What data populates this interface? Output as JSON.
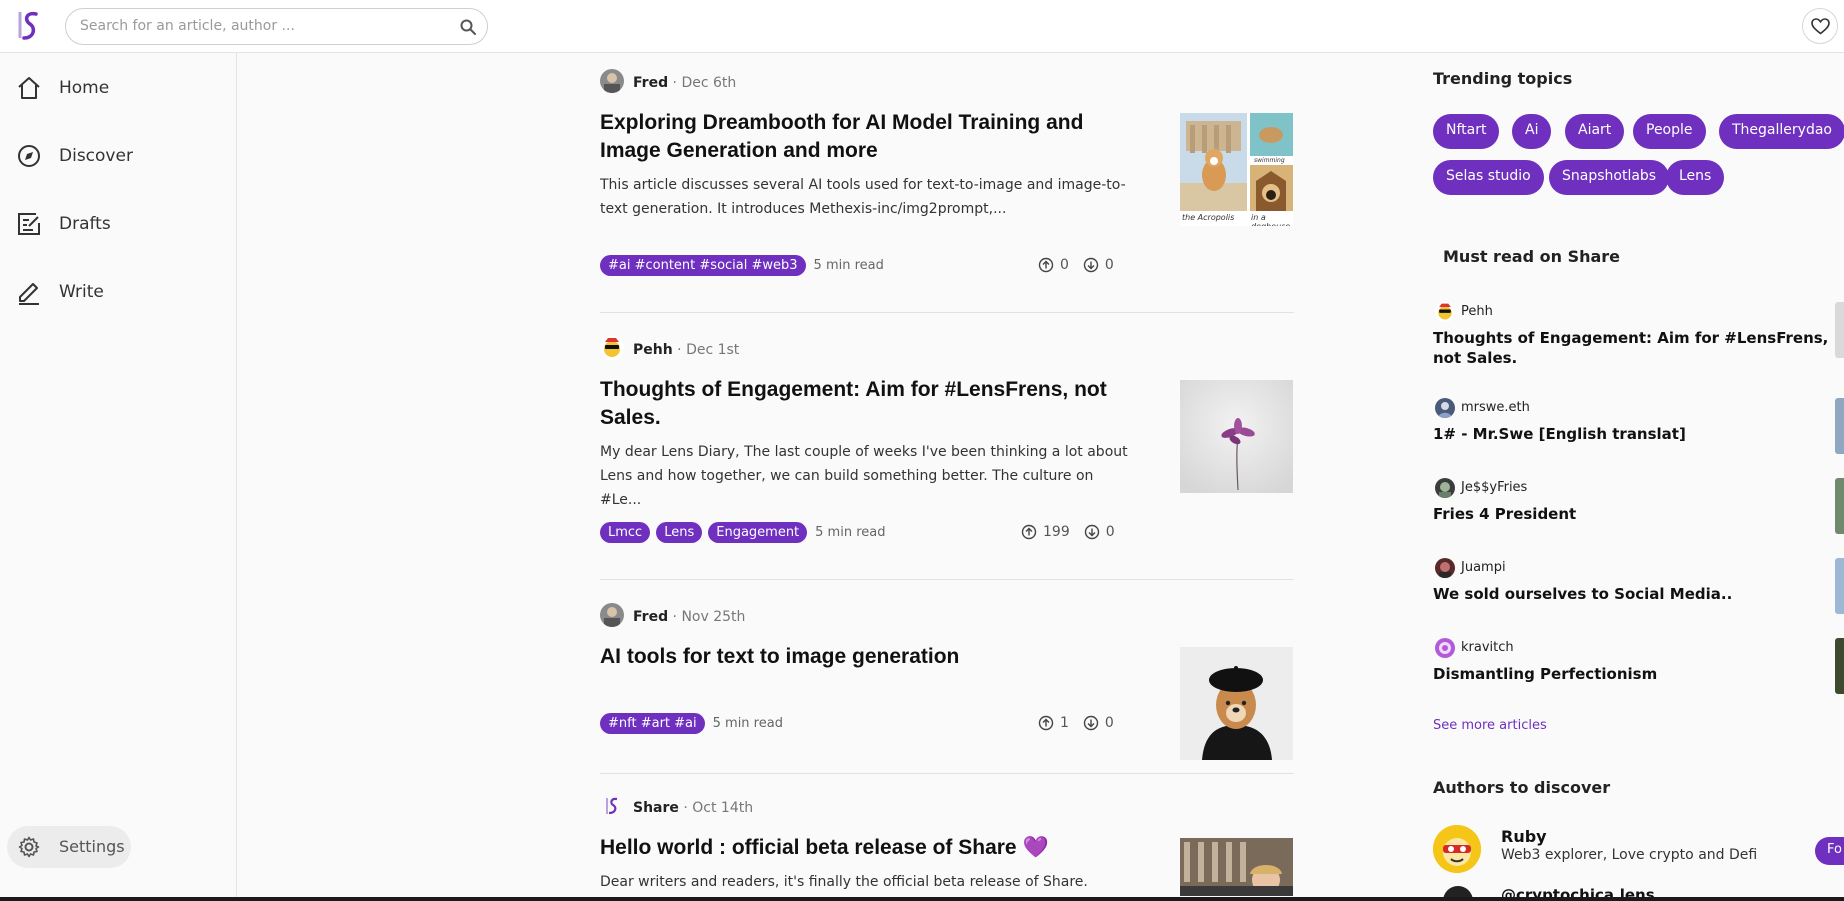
{
  "header": {
    "search_placeholder": "Search for an article, author ...",
    "brand_color": "#6f2fbf"
  },
  "sidebar": {
    "items": [
      {
        "label": "Home",
        "icon": "home-icon"
      },
      {
        "label": "Discover",
        "icon": "compass-icon"
      },
      {
        "label": "Drafts",
        "icon": "drafts-icon"
      },
      {
        "label": "Write",
        "icon": "pencil-icon"
      }
    ],
    "settings_label": "Settings"
  },
  "articles": [
    {
      "author": "Fred",
      "date": "Dec 6th",
      "title": "Exploring Dreambooth for AI Model Training and Image Generation and more",
      "excerpt": "This article discusses several AI tools used for text-to-image and image-to-text generation. It introduces Methexis-inc/img2prompt,...",
      "tags": [
        "#ai #content #social #web3"
      ],
      "read_time": "5 min read",
      "upvotes": "0",
      "collects": "0",
      "thumb_captions": [
        "swimming",
        "the Acropolis",
        "in a doghouse"
      ]
    },
    {
      "author": "Pehh",
      "date": "Dec 1st",
      "title": "Thoughts of Engagement: Aim for #LensFrens, not Sales.",
      "excerpt": "My dear Lens Diary, The last couple of weeks I've been thinking a lot about Lens and how together, we can build something better. The culture on #Le...",
      "tags": [
        "Lmcc",
        "Lens",
        "Engagement"
      ],
      "read_time": "5 min read",
      "upvotes": "199",
      "collects": "0"
    },
    {
      "author": "Fred",
      "date": "Nov 25th",
      "title": "AI tools for text to image generation",
      "excerpt": "",
      "tags": [
        "#nft #art #ai"
      ],
      "read_time": "5 min read",
      "upvotes": "1",
      "collects": "0"
    },
    {
      "author": "Share",
      "date": "Oct 14th",
      "title": "Hello world : official beta release of Share 💜",
      "excerpt": "Dear writers and readers, it's finally the official beta release of Share."
    }
  ],
  "trending": {
    "title": "Trending topics",
    "topics": [
      "Nftart",
      "Ai",
      "Aiart",
      "People",
      "Thegallerydao",
      "Selas studio",
      "Snapshotlabs",
      "Lens"
    ]
  },
  "must_read": {
    "title": "Must read on Share",
    "items": [
      {
        "author": "Pehh",
        "title": "Thoughts of Engagement: Aim for #LensFrens, not Sales."
      },
      {
        "author": "mrswe.eth",
        "title": "1# - Mr.Swe [English translat]"
      },
      {
        "author": "Je$$yFries",
        "title": "Fries 4 President"
      },
      {
        "author": "Juampi",
        "title": "We sold ourselves to Social Media.."
      },
      {
        "author": "kravitch",
        "title": "Dismantling Perfectionism"
      }
    ],
    "see_more": "See more articles"
  },
  "authors": {
    "title": "Authors to discover",
    "list": [
      {
        "name": "Ruby",
        "bio": "Web3 explorer, Love crypto and Defi",
        "follow": "Fo"
      },
      {
        "name": "@cryptochica.lens"
      }
    ]
  }
}
